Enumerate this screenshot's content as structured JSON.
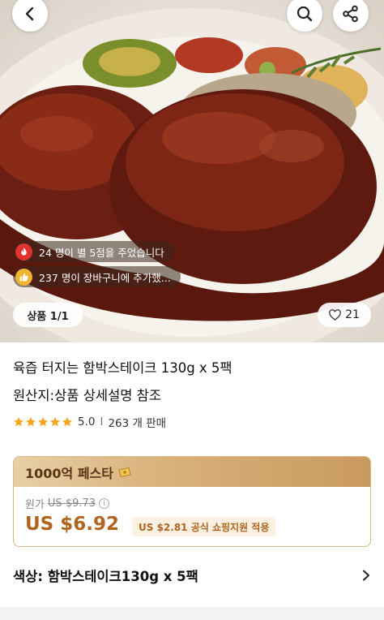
{
  "hero": {
    "social_proof": [
      {
        "icon": "fire-icon",
        "text": "24 명이 별 5점을 주었습니다"
      },
      {
        "icon": "thumbs-up-icon",
        "text": "237 명이 장바구니에 추가했..."
      }
    ],
    "image_counter": "상품 1/1",
    "like_count": "21"
  },
  "product": {
    "title": "육즙 터지는 함박스테이크 130g x 5팩",
    "origin": "원산지:상품 상세설명 참조",
    "rating": "5.0",
    "rating_separator": "I",
    "sold": "263 개 판매",
    "stars": 5
  },
  "festival": {
    "title": "1000억 페스타",
    "original_label": "원가",
    "original_price": "US $9.73",
    "sale_price": "US $6.92",
    "subsidy": "US $2.81 공식 쇼핑지원 적용"
  },
  "option": {
    "label": "색상: 함박스테이크130g x 5팩"
  },
  "colors": {
    "price_accent": "#b0651f",
    "star": "#f5a623",
    "festival_gold": "#d9b27c"
  }
}
